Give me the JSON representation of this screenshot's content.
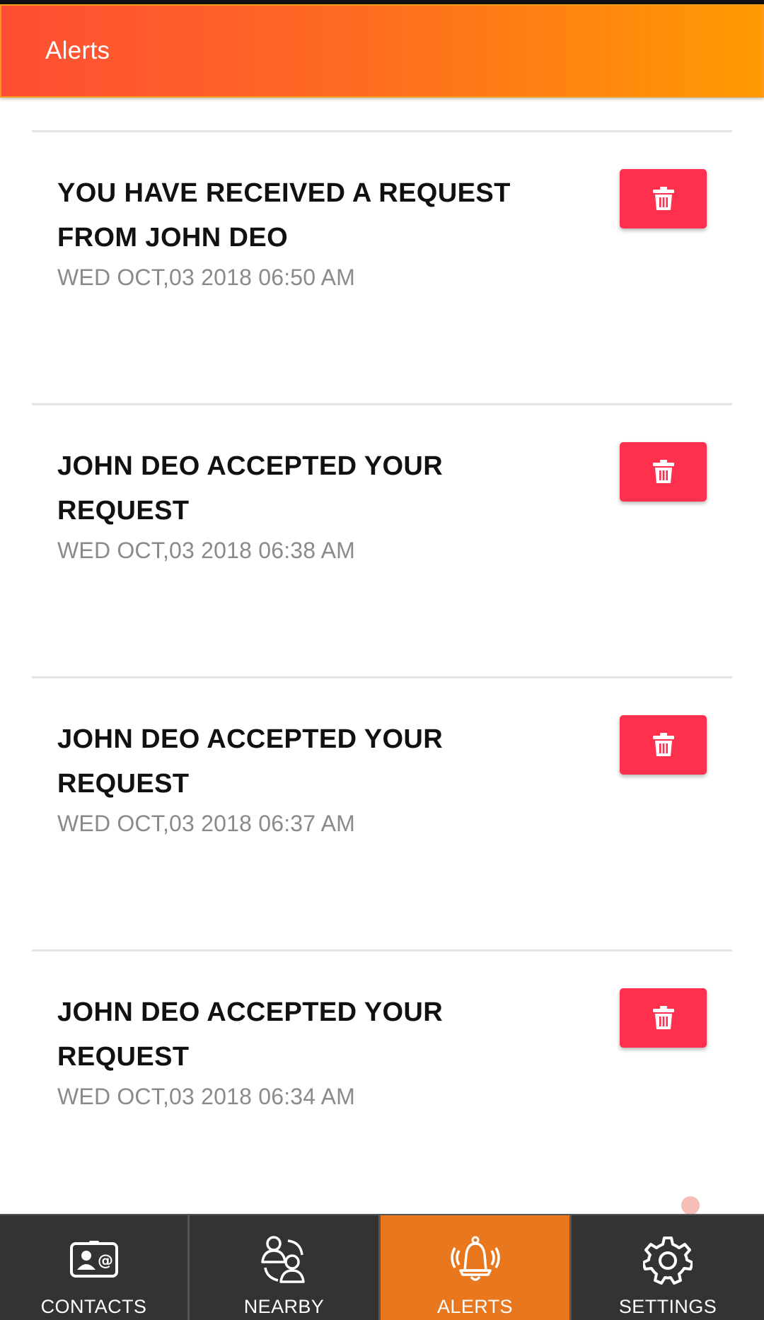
{
  "header": {
    "title": "Alerts"
  },
  "alerts": [
    {
      "title": "YOU HAVE RECEIVED A REQUEST FROM JOHN DEO",
      "timestamp": "WED OCT,03 2018 06:50 AM"
    },
    {
      "title": "JOHN DEO ACCEPTED YOUR REQUEST",
      "timestamp": "WED OCT,03 2018 06:38 AM"
    },
    {
      "title": "JOHN DEO ACCEPTED YOUR REQUEST",
      "timestamp": "WED OCT,03 2018 06:37 AM"
    },
    {
      "title": "JOHN DEO ACCEPTED YOUR REQUEST",
      "timestamp": "WED OCT,03 2018 06:34 AM"
    }
  ],
  "delete_icon": "trash-icon",
  "nav": {
    "items": [
      {
        "label": "CONTACTS",
        "icon": "contact-card-icon"
      },
      {
        "label": "NEARBY",
        "icon": "people-nearby-icon"
      },
      {
        "label": "ALERTS",
        "icon": "bell-ringing-icon",
        "active": true
      },
      {
        "label": "SETTINGS",
        "icon": "gear-icon"
      }
    ]
  },
  "colors": {
    "header_gradient_start": "#ff4e34",
    "header_gradient_end": "#ff9a00",
    "delete_button": "#ff2f4e",
    "nav_background": "#333333",
    "nav_active": "#e8771e",
    "timestamp_text": "#8a8a8a"
  }
}
